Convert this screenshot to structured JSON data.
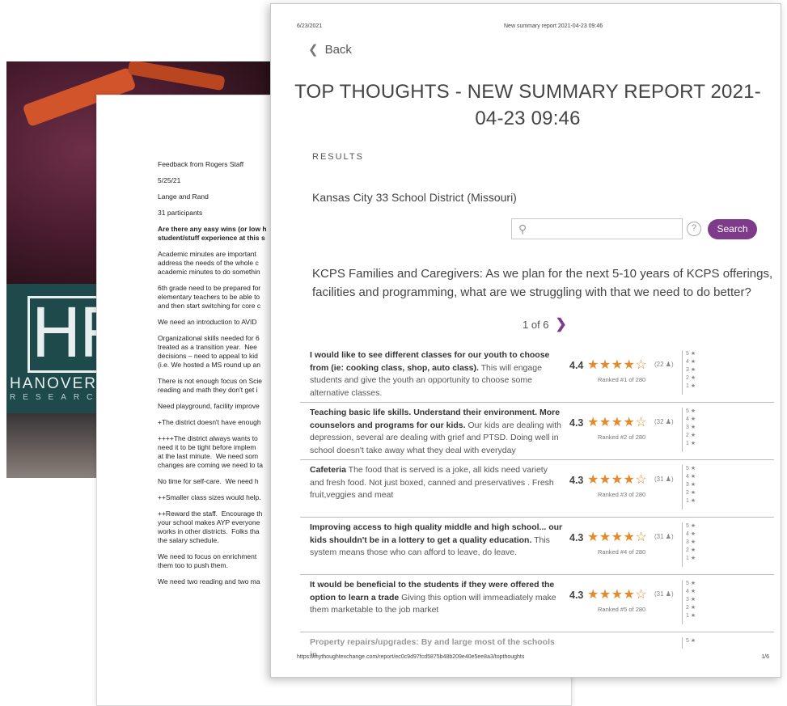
{
  "cover": {
    "logo_name": "HANOVER",
    "logo_sub": "RESEARCH",
    "brand_color": "#1f4a4c"
  },
  "memo": {
    "lines": [
      {
        "text": "Feedback from Rogers Staff",
        "bold": false
      },
      {
        "text": "5/25/21",
        "bold": false
      },
      {
        "text": "Lange and Rand",
        "bold": false
      },
      {
        "text": "31 participants",
        "bold": false
      },
      {
        "text": "Are there any easy wins (or low h\nstudent/stuff experience at this s",
        "bold": true
      },
      {
        "text": "Academic minutes are important\naddress the needs of the whole c\nacademic minutes to do somethin",
        "bold": false
      },
      {
        "text": "6th grade need to be prepared for\nelementary teachers to be able to\nand then start switching for core c",
        "bold": false
      },
      {
        "text": "We need an introduction to AVID",
        "bold": false
      },
      {
        "text": "Organizational skills needed for 6\ntreated as a transition year.  Nee\ndecisions – need to appeal to kid\n(i.e. We hosted a MS round up an",
        "bold": false
      },
      {
        "text": "There is not enough focus on Scie\nreading and math they don't get i",
        "bold": false
      },
      {
        "text": "Need playground, facility improve",
        "bold": false
      },
      {
        "text": "+The district doesn't have enough",
        "bold": false
      },
      {
        "text": "++++The district always wants to\nneed it to be tight before implem\nat the last minute.  We need som\nchanges are coming we need to ta",
        "bold": false
      },
      {
        "text": "No time for self-care.  We need h",
        "bold": false
      },
      {
        "text": "++Smaller class sizes would help.",
        "bold": false
      },
      {
        "text": "++Reward the staff.  Encourage th\nyour school makes AYP everyone\nworks in other districts.  Folks tha\nthe salary schedule.",
        "bold": false
      },
      {
        "text": "We need to focus on enrichment\nthem too to push them.",
        "bold": false
      },
      {
        "text": "We need two reading and two ma",
        "bold": false
      }
    ]
  },
  "report": {
    "print_date": "6/23/2021",
    "print_title": "New summary report 2021-04-23 09:46",
    "back_label": "Back",
    "title": "TOP THOUGHTS - NEW SUMMARY REPORT 2021-04-23 09:46",
    "results_label": "RESULTS",
    "district": "Kansas City 33 School District (Missouri)",
    "search": {
      "placeholder": "",
      "value": "",
      "button_label": "Search",
      "help_glyph": "?"
    },
    "question": "KCPS Families and Caregivers: As we plan for the next 5-10 years of KCPS offerings, facilities and programming, what are we struggling with that we need to do better?",
    "pager": {
      "text": "1 of 6"
    },
    "accent_color": "#7e3b8a",
    "star_color": "#e58a2b",
    "thoughts": [
      {
        "bold": "I would like to see different classes for our youth to choose from (ie: cooking class, shop, auto class).",
        "rest": " This will engage students and give the youth an opportunity to choose some alternative classes.",
        "score": "4.4",
        "stars_filled": 4,
        "count": "(22 ♟)",
        "rank": "Ranked #1 of 280"
      },
      {
        "bold": "Teaching basic life skills. Understand their environment. More counselors and programs for our kids.",
        "rest": " Our kids are dealing with depression, several are dealing with grief and PTSD. Doing well in school doesn't take away what they deal with everyday",
        "score": "4.3",
        "stars_filled": 4,
        "count": "(32 ♟)",
        "rank": "Ranked #2 of 280"
      },
      {
        "bold": "Cafeteria",
        "rest": " The food that is served is a joke, all kids need variety and fresh food. Not just boxed, canned and preservatives . Fresh fruit,veggies and meat",
        "score": "4.3",
        "stars_filled": 4,
        "count": "(31 ♟)",
        "rank": "Ranked #3 of 280"
      },
      {
        "bold": "Improving access to high quality middle and high school... our kids shouldn't be in a lottery to get a quality education.",
        "rest": " This system means those who can afford to leave, do leave.",
        "score": "4.3",
        "stars_filled": 4,
        "count": "(31 ♟)",
        "rank": "Ranked #4 of 280"
      },
      {
        "bold": "It would be beneficial to the students if they were offered the option to learn a trade",
        "rest": " Giving this option will immeadiately make them marketable to the job market",
        "score": "4.3",
        "stars_filled": 4,
        "count": "(31 ♟)",
        "rank": "Ranked #5 of 280"
      }
    ],
    "partial_thought": "Property repairs/upgrades: By and large most of the schools in",
    "footer_url": "https://mythoughtexchange.com/report/ec0c9d97fcd5875b48b209e40e5ee8a3/topthoughts",
    "footer_page": "1/6"
  }
}
